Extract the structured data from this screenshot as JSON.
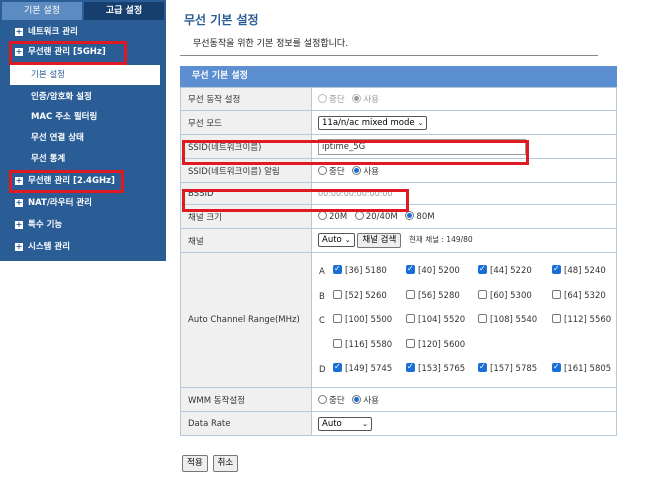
{
  "sidebar": {
    "tabs": {
      "basic": "기본 설정",
      "advanced": "고급 설정"
    },
    "items": [
      {
        "label": "네트워크 관리"
      },
      {
        "label": "무선랜 관리 [5GHz]"
      },
      {
        "label": "무선랜 관리 [2.4GHz]"
      },
      {
        "label": "NAT/라우터 관리"
      },
      {
        "label": "특수 기능"
      },
      {
        "label": "시스템 관리"
      }
    ],
    "subitems": [
      {
        "label": "기본 설정"
      },
      {
        "label": "인증/암호화 설정"
      },
      {
        "label": "MAC 주소 필터링"
      },
      {
        "label": "무선 연결 상태"
      },
      {
        "label": "무선 통계"
      }
    ],
    "icon": "+"
  },
  "main": {
    "title": "무선 기본 설정",
    "description": "무선동작을 위한 기본 정보를 설정합니다.",
    "panel_title": "무선 기본 설정",
    "rows": {
      "wireless_op": {
        "label": "무선 동작 설정",
        "opt_off": "중단",
        "opt_on": "사용"
      },
      "wireless_mode": {
        "label": "무선 모드",
        "value": "11a/n/ac mixed mode"
      },
      "ssid": {
        "label": "SSID(네트워크이름)",
        "value": "iptime_5G"
      },
      "ssid_broadcast": {
        "label": "SSID(네트워크이름) 알림",
        "opt_off": "중단",
        "opt_on": "사용"
      },
      "bssid": {
        "label": "BSSID",
        "value": "00:00:00:00:00:00"
      },
      "channel_width": {
        "label": "채널 크기",
        "opt1": "20M",
        "opt2": "20/40M",
        "opt3": "80M"
      },
      "channel": {
        "label": "채널",
        "value": "Auto",
        "search": "채널 검색",
        "current": "현재 채널 : 149/80"
      },
      "acr": {
        "label": "Auto Channel Range(MHz)"
      },
      "wmm": {
        "label": "WMM 동작설정",
        "opt_off": "중단",
        "opt_on": "사용"
      },
      "data_rate": {
        "label": "Data Rate",
        "value": "Auto"
      }
    },
    "bands": [
      "A",
      "B",
      "C",
      "D"
    ],
    "channels": [
      {
        "label": "[36] 5180",
        "checked": true
      },
      {
        "label": "[40] 5200",
        "checked": true
      },
      {
        "label": "[44] 5220",
        "checked": true
      },
      {
        "label": "[48] 5240",
        "checked": true
      },
      {
        "label": "[52] 5260",
        "checked": false
      },
      {
        "label": "[56] 5280",
        "checked": false
      },
      {
        "label": "[60] 5300",
        "checked": false
      },
      {
        "label": "[64] 5320",
        "checked": false
      },
      {
        "label": "[100] 5500",
        "checked": false
      },
      {
        "label": "[104] 5520",
        "checked": false
      },
      {
        "label": "[108] 5540",
        "checked": false
      },
      {
        "label": "[112] 5560",
        "checked": false
      },
      {
        "label": "[116] 5580",
        "checked": false
      },
      {
        "label": "[120] 5600",
        "checked": false
      },
      {
        "label": "[149] 5745",
        "checked": true
      },
      {
        "label": "[153] 5765",
        "checked": true
      },
      {
        "label": "[157] 5785",
        "checked": true
      },
      {
        "label": "[161] 5805",
        "checked": true
      }
    ],
    "apply": "적용",
    "cancel": "취소"
  },
  "colors": {
    "sidebar_bg": "#2a5d96",
    "panel_header": "#5b8fd1",
    "highlight_box": "#e01a22",
    "accent": "#1a6fd6"
  }
}
